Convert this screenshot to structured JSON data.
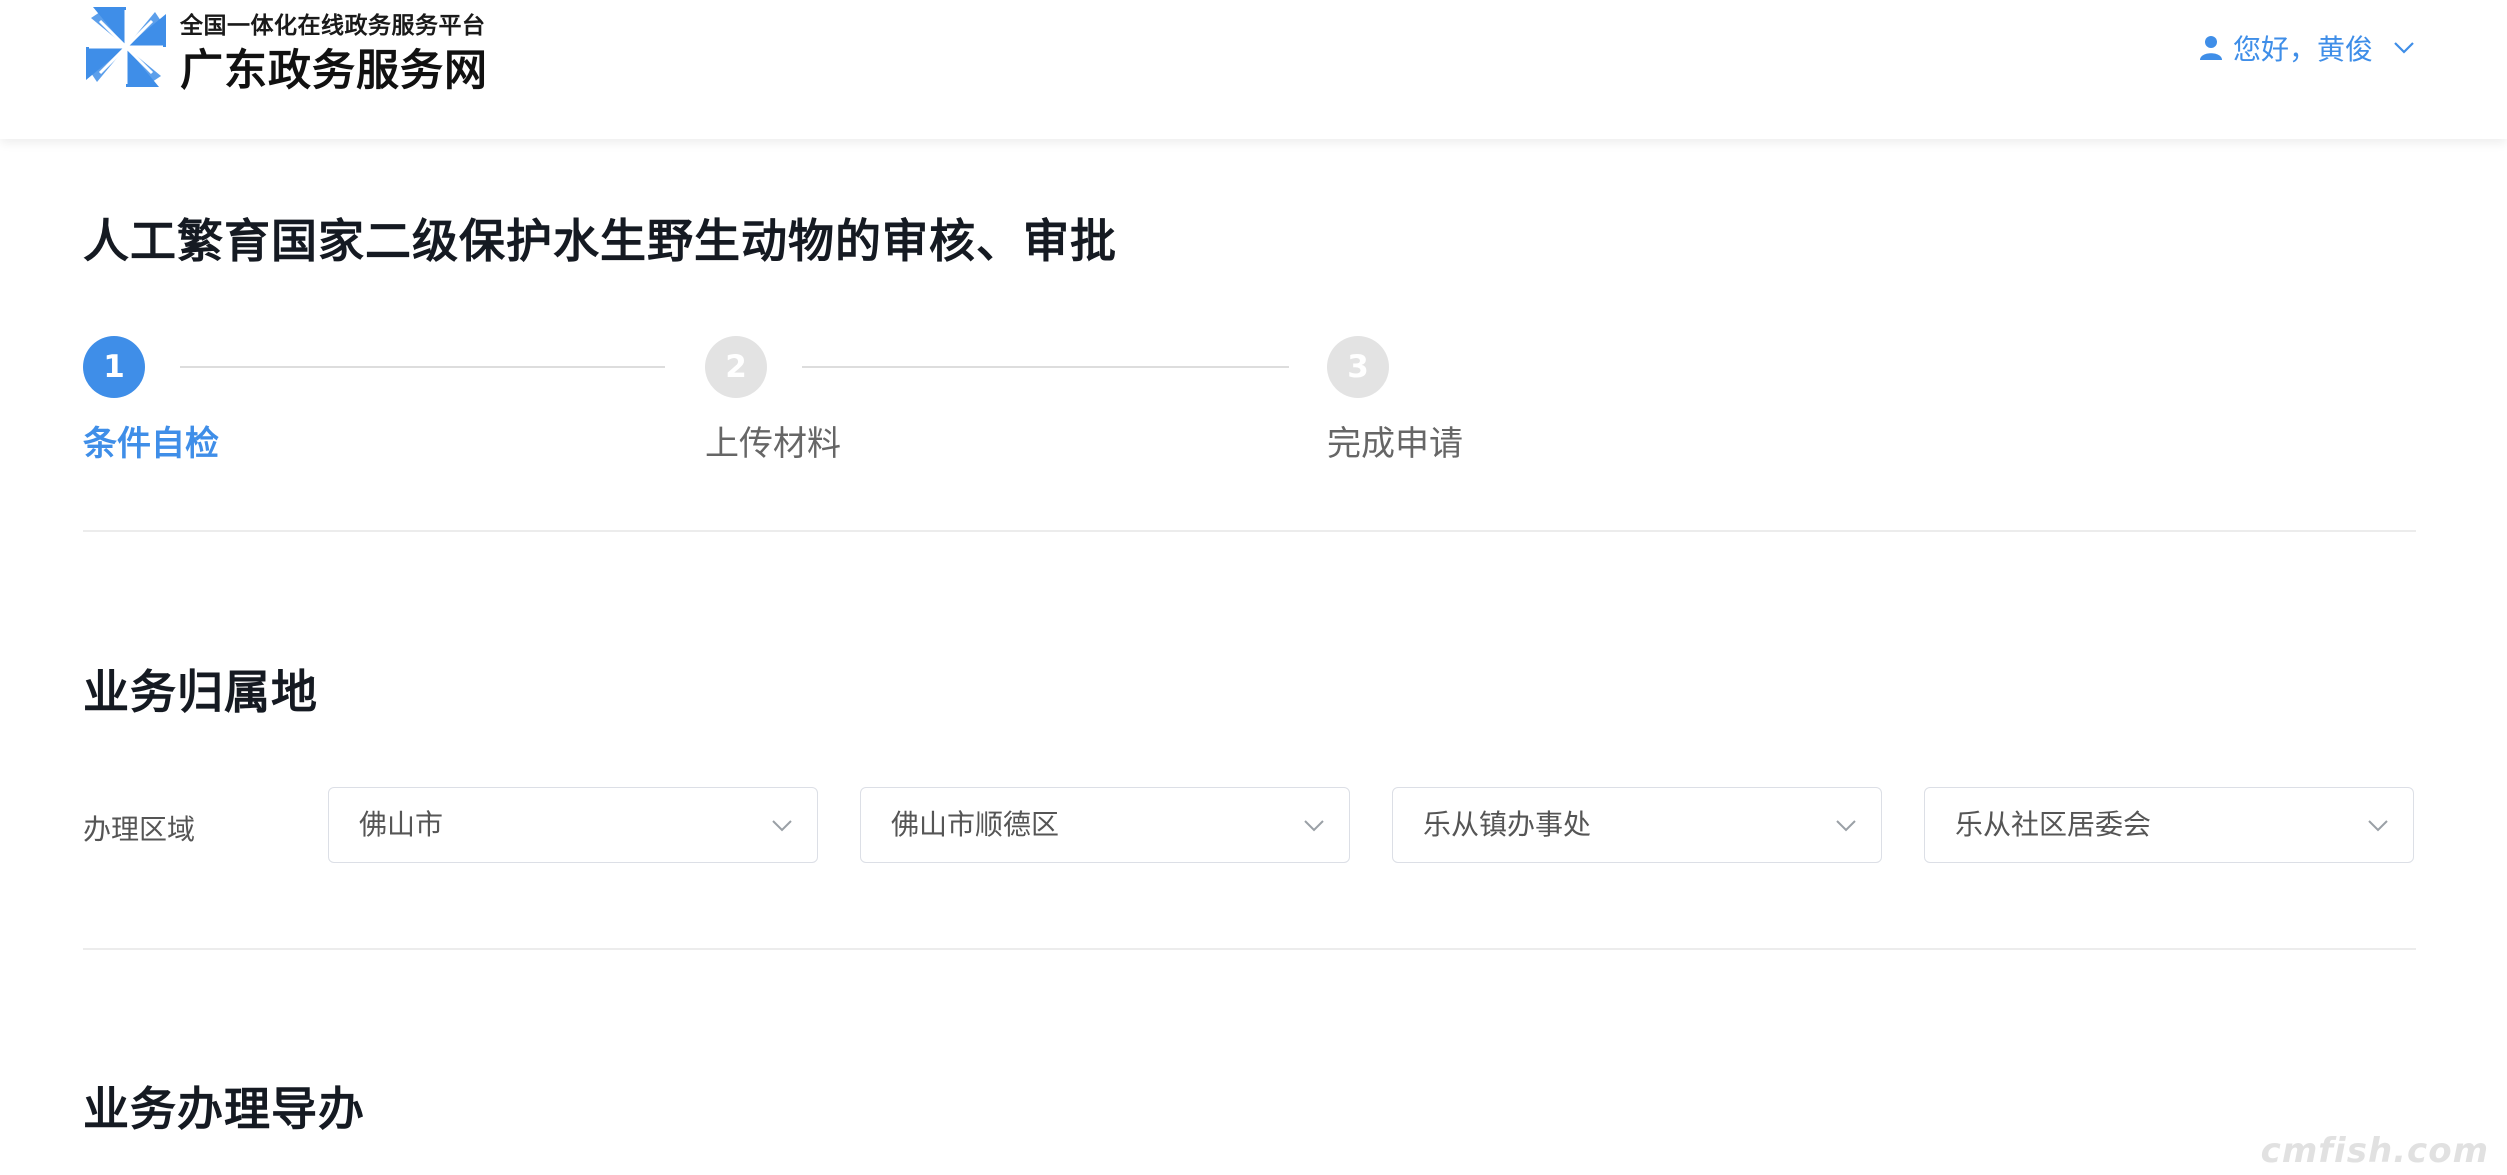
{
  "header": {
    "subtitle": "全国一体化在线政务服务平台",
    "title": "广东政务服务网",
    "user_greeting": "您好，黄俊"
  },
  "page": {
    "title": "人工繁育国家二级保护水生野生动物的审核、审批"
  },
  "steps": [
    {
      "number": "1",
      "label": "条件自检",
      "active": true
    },
    {
      "number": "2",
      "label": "上传材料",
      "active": false
    },
    {
      "number": "3",
      "label": "完成申请",
      "active": false
    }
  ],
  "business_location": {
    "title": "业务归属地",
    "field_label": "办理区域",
    "selects": [
      {
        "value": "佛山市"
      },
      {
        "value": "佛山市顺德区"
      },
      {
        "value": "乐从镇办事处"
      },
      {
        "value": "乐从社区居委会"
      }
    ]
  },
  "guide": {
    "title": "业务办理导办"
  },
  "watermark": "cmfish.com",
  "colors": {
    "accent": "#3f8ee8",
    "inactive_step": "#e3e3e3",
    "divider": "#ececec"
  }
}
